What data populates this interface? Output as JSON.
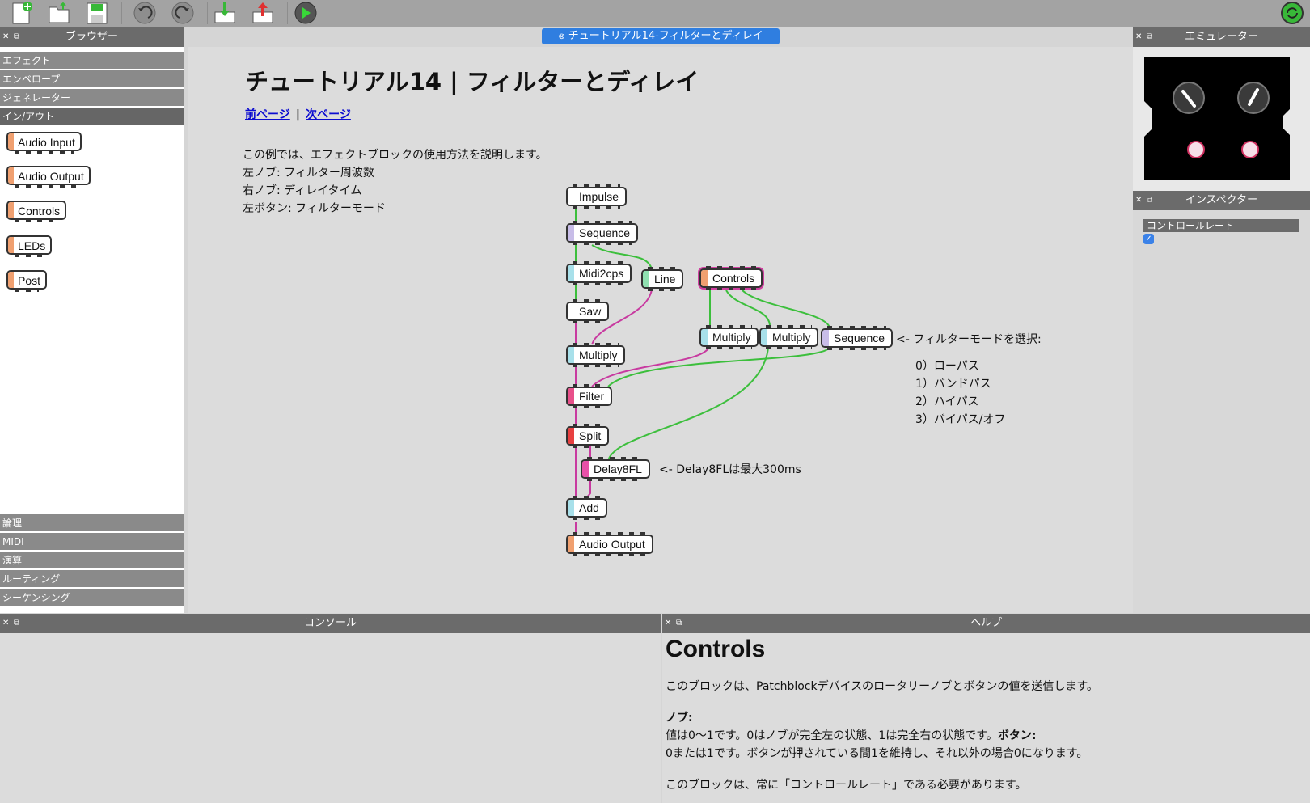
{
  "toolbar": {
    "buttons": [
      "new-file",
      "open-file",
      "save-file",
      "undo",
      "redo",
      "download",
      "upload",
      "run"
    ],
    "icons": {
      "new": "document-plus-icon",
      "open": "folder-icon",
      "save": "floppy-disk-icon",
      "undo": "undo-icon",
      "redo": "redo-icon",
      "download": "download-icon",
      "upload": "upload-icon",
      "run": "play-icon",
      "device": "device-sync-icon"
    }
  },
  "panels": {
    "browser": "ブラウザー",
    "emulator": "エミュレーター",
    "inspector": "インスペクター",
    "console": "コンソール",
    "help": "ヘルプ"
  },
  "browser": {
    "categories_top": [
      "エフェクト",
      "エンベロープ",
      "ジェネレーター",
      "イン/アウト"
    ],
    "blocks": [
      "Audio Input",
      "Audio Output",
      "Controls",
      "LEDs",
      "Post"
    ],
    "categories_bottom": [
      "論理",
      "MIDI",
      "演算",
      "ルーティング",
      "シーケンシング"
    ]
  },
  "main": {
    "tab": "チュートリアル14-フィルターとディレイ",
    "title": "チュートリアル14 | フィルターとディレイ",
    "prev": "前ページ",
    "sep": "|",
    "next": "次ページ",
    "desc": [
      "この例では、エフェクトブロックの使用方法を説明します。",
      "左ノブ: フィルター周波数",
      "右ノブ: ディレイタイム",
      "左ボタン: フィルターモード"
    ],
    "blocks": {
      "impulse": "Impulse",
      "sequence1": "Sequence",
      "midi2cps": "Midi2cps",
      "line": "Line",
      "saw": "Saw",
      "multiply1": "Multiply",
      "filter": "Filter",
      "split": "Split",
      "delay": "Delay8FL",
      "add": "Add",
      "audio_output": "Audio Output",
      "controls": "Controls",
      "multiply2": "Multiply",
      "multiply3": "Multiply",
      "sequence2": "Sequence"
    },
    "notes": {
      "filter_mode": "<- フィルターモードを選択:",
      "modes": [
        "0）ローパス",
        "1）バンドパス",
        "2）ハイパス",
        "3）バイパス/オフ"
      ],
      "delay": "<- Delay8FLは最大300ms"
    }
  },
  "inspector": {
    "row": "コントロールレート",
    "checked": "✓"
  },
  "help": {
    "title": "Controls",
    "p1": "このブロックは、Patchblockデバイスのロータリーノブとボタンの値を送信します。",
    "h_knob": "ノブ:",
    "p2a": "値は0〜1です。0はノブが完全左の状態、1は完全右の状態です。",
    "h_button": "ボタン:",
    "p3": "0または1です。ボタンが押されている間1を維持し、それ以外の場合0になります。",
    "p4": "このブロックは、常に「コントロールレート」である必要があります。"
  },
  "colors": {
    "accent_tab": "#2f7ee0",
    "wire_green": "#3cbf3c",
    "wire_magenta": "#c83aa0",
    "header_gray": "#6b6b6b"
  }
}
